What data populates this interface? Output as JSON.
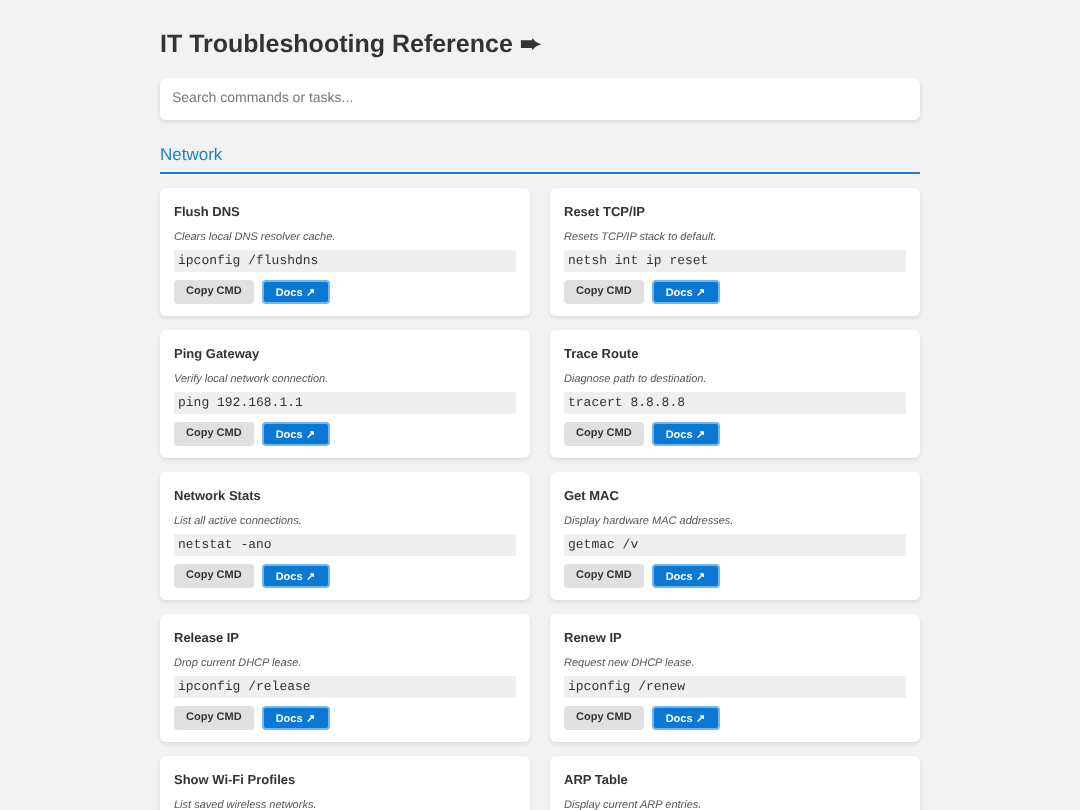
{
  "title": "IT Troubleshooting Reference ➨",
  "search": {
    "placeholder": "Search commands or tasks..."
  },
  "sections": [
    {
      "heading": "Network",
      "cards": [
        {
          "title": "Flush DNS",
          "description": "Clears local DNS resolver cache.",
          "command": "ipconfig /flushdns",
          "buttons": [
            {
              "label": "Copy CMD",
              "kind": "copy"
            },
            {
              "label": "Docs ↗",
              "kind": "docs"
            }
          ]
        },
        {
          "title": "Reset TCP/IP",
          "description": "Resets TCP/IP stack to default.",
          "command": "netsh int ip reset",
          "buttons": [
            {
              "label": "Copy CMD",
              "kind": "copy"
            },
            {
              "label": "Docs ↗",
              "kind": "docs"
            }
          ]
        },
        {
          "title": "Ping Gateway",
          "description": "Verify local network connection.",
          "command": "ping 192.168.1.1",
          "buttons": [
            {
              "label": "Copy CMD",
              "kind": "copy"
            },
            {
              "label": "Docs ↗",
              "kind": "docs"
            }
          ]
        },
        {
          "title": "Trace Route",
          "description": "Diagnose path to destination.",
          "command": "tracert 8.8.8.8",
          "buttons": [
            {
              "label": "Copy CMD",
              "kind": "copy"
            },
            {
              "label": "Docs ↗",
              "kind": "docs"
            }
          ]
        },
        {
          "title": "Network Stats",
          "description": "List all active connections.",
          "command": "netstat -ano",
          "buttons": [
            {
              "label": "Copy CMD",
              "kind": "copy"
            },
            {
              "label": "Docs ↗",
              "kind": "docs"
            }
          ]
        },
        {
          "title": "Get MAC",
          "description": "Display hardware MAC addresses.",
          "command": "getmac /v",
          "buttons": [
            {
              "label": "Copy CMD",
              "kind": "copy"
            },
            {
              "label": "Docs ↗",
              "kind": "docs"
            }
          ]
        },
        {
          "title": "Release IP",
          "description": "Drop current DHCP lease.",
          "command": "ipconfig /release",
          "buttons": [
            {
              "label": "Copy CMD",
              "kind": "copy"
            },
            {
              "label": "Docs ↗",
              "kind": "docs"
            }
          ]
        },
        {
          "title": "Renew IP",
          "description": "Request new DHCP lease.",
          "command": "ipconfig /renew",
          "buttons": [
            {
              "label": "Copy CMD",
              "kind": "copy"
            },
            {
              "label": "Docs ↗",
              "kind": "docs"
            }
          ]
        },
        {
          "title": "Show Wi-Fi Profiles",
          "description": "List saved wireless networks."
        },
        {
          "title": "ARP Table",
          "description": "Display current ARP entries."
        }
      ]
    }
  ]
}
